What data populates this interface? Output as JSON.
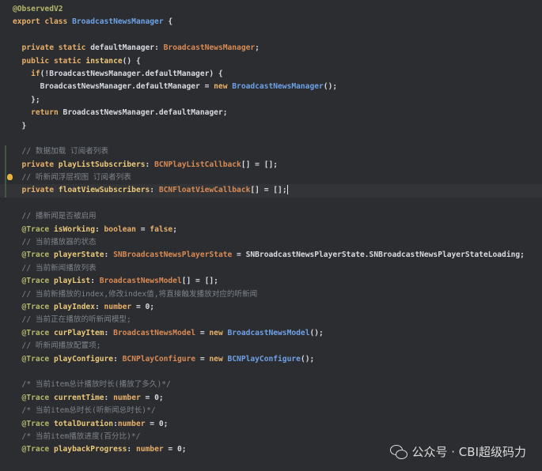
{
  "editor": {
    "lines": [
      {
        "tokens": [
          {
            "t": "@ObservedV2",
            "c": "anno"
          }
        ]
      },
      {
        "tokens": [
          {
            "t": "export class ",
            "c": "kw"
          },
          {
            "t": "BroadcastNewsManager",
            "c": "cls"
          },
          {
            "t": " {",
            "c": "plain"
          }
        ]
      },
      {
        "tokens": []
      },
      {
        "tokens": [
          {
            "t": "  private static ",
            "c": "kw"
          },
          {
            "t": "defaultManager",
            "c": "plain"
          },
          {
            "t": ": ",
            "c": "plain"
          },
          {
            "t": "BroadcastNewsManager",
            "c": "type"
          },
          {
            "t": ";",
            "c": "plain"
          }
        ]
      },
      {
        "tokens": [
          {
            "t": "  public static ",
            "c": "kw"
          },
          {
            "t": "instance",
            "c": "fld"
          },
          {
            "t": "() {",
            "c": "plain"
          }
        ]
      },
      {
        "tokens": [
          {
            "t": "    if",
            "c": "kw"
          },
          {
            "t": "(!BroadcastNewsManager.defaultManager) {",
            "c": "plain"
          }
        ]
      },
      {
        "tokens": [
          {
            "t": "      BroadcastNewsManager.defaultManager = ",
            "c": "plain"
          },
          {
            "t": "new ",
            "c": "kw"
          },
          {
            "t": "BroadcastNewsManager",
            "c": "cls"
          },
          {
            "t": "();",
            "c": "plain"
          }
        ]
      },
      {
        "tokens": [
          {
            "t": "    };",
            "c": "plain"
          }
        ]
      },
      {
        "tokens": [
          {
            "t": "    return ",
            "c": "kw"
          },
          {
            "t": "BroadcastNewsManager.defaultManager;",
            "c": "plain"
          }
        ]
      },
      {
        "tokens": [
          {
            "t": "  }",
            "c": "plain"
          }
        ]
      },
      {
        "tokens": []
      },
      {
        "tokens": [
          {
            "t": "  // 数据加载 订阅者列表",
            "c": "comment"
          }
        ]
      },
      {
        "tokens": [
          {
            "t": "  private ",
            "c": "kw"
          },
          {
            "t": "playListSubscribers",
            "c": "fld"
          },
          {
            "t": ": ",
            "c": "plain"
          },
          {
            "t": "BCNPlayListCallback",
            "c": "type"
          },
          {
            "t": "[] = [];",
            "c": "plain"
          }
        ]
      },
      {
        "tokens": [
          {
            "t": "  // 听新闻浮层视图 订阅者列表",
            "c": "comment"
          }
        ],
        "bulb": true
      },
      {
        "tokens": [
          {
            "t": "  private ",
            "c": "kw"
          },
          {
            "t": "floatViewSubscribers",
            "c": "fld"
          },
          {
            "t": ": ",
            "c": "plain"
          },
          {
            "t": "BCNFloatViewCallback",
            "c": "type"
          },
          {
            "t": "[] = [];",
            "c": "plain"
          }
        ],
        "current": true
      },
      {
        "tokens": []
      },
      {
        "tokens": [
          {
            "t": "  // 播新闻是否被启用",
            "c": "comment"
          }
        ]
      },
      {
        "tokens": [
          {
            "t": "  @Trace ",
            "c": "anno"
          },
          {
            "t": "isWorking",
            "c": "fld"
          },
          {
            "t": ": ",
            "c": "plain"
          },
          {
            "t": "boolean",
            "c": "kw"
          },
          {
            "t": " = ",
            "c": "plain"
          },
          {
            "t": "false",
            "c": "kw"
          },
          {
            "t": ";",
            "c": "plain"
          }
        ]
      },
      {
        "tokens": [
          {
            "t": "  // 当前播放器的状态",
            "c": "comment"
          }
        ]
      },
      {
        "tokens": [
          {
            "t": "  @Trace ",
            "c": "anno"
          },
          {
            "t": "playerState",
            "c": "fld"
          },
          {
            "t": ": ",
            "c": "plain"
          },
          {
            "t": "SNBroadcastNewsPlayerState",
            "c": "type"
          },
          {
            "t": " = SNBroadcastNewsPlayerState.SNBroadcastNewsPlayerStateLoading;",
            "c": "plain"
          }
        ]
      },
      {
        "tokens": [
          {
            "t": "  // 当前新闻播放列表",
            "c": "comment"
          }
        ]
      },
      {
        "tokens": [
          {
            "t": "  @Trace ",
            "c": "anno"
          },
          {
            "t": "playList",
            "c": "fld"
          },
          {
            "t": ": ",
            "c": "plain"
          },
          {
            "t": "BroadcastNewsModel",
            "c": "type"
          },
          {
            "t": "[] = [];",
            "c": "plain"
          }
        ]
      },
      {
        "tokens": [
          {
            "t": "  // 当前新播放的index,修改index值,将直接触发播放对应的听新闻",
            "c": "comment"
          }
        ]
      },
      {
        "tokens": [
          {
            "t": "  @Trace ",
            "c": "anno"
          },
          {
            "t": "playIndex",
            "c": "fld"
          },
          {
            "t": ": ",
            "c": "plain"
          },
          {
            "t": "number",
            "c": "kw"
          },
          {
            "t": " = 0;",
            "c": "plain"
          }
        ]
      },
      {
        "tokens": [
          {
            "t": "  // 当前正在播放的听新闻模型;",
            "c": "comment"
          }
        ]
      },
      {
        "tokens": [
          {
            "t": "  @Trace ",
            "c": "anno"
          },
          {
            "t": "curPlayItem",
            "c": "fld"
          },
          {
            "t": ": ",
            "c": "plain"
          },
          {
            "t": "BroadcastNewsModel",
            "c": "type"
          },
          {
            "t": " = ",
            "c": "plain"
          },
          {
            "t": "new ",
            "c": "kw"
          },
          {
            "t": "BroadcastNewsModel",
            "c": "cls"
          },
          {
            "t": "();",
            "c": "plain"
          }
        ]
      },
      {
        "tokens": [
          {
            "t": "  // 听新闻播放配置项;",
            "c": "comment"
          }
        ]
      },
      {
        "tokens": [
          {
            "t": "  @Trace ",
            "c": "anno"
          },
          {
            "t": "playConfigure",
            "c": "fld"
          },
          {
            "t": ": ",
            "c": "plain"
          },
          {
            "t": "BCNPlayConfigure",
            "c": "type"
          },
          {
            "t": " = ",
            "c": "plain"
          },
          {
            "t": "new ",
            "c": "kw"
          },
          {
            "t": "BCNPlayConfigure",
            "c": "cls"
          },
          {
            "t": "();",
            "c": "plain"
          }
        ]
      },
      {
        "tokens": []
      },
      {
        "tokens": [
          {
            "t": "  /* 当前item总计播放时长(播放了多久)*/",
            "c": "comment"
          }
        ]
      },
      {
        "tokens": [
          {
            "t": "  @Trace ",
            "c": "anno"
          },
          {
            "t": "currentTime",
            "c": "fld"
          },
          {
            "t": ": ",
            "c": "plain"
          },
          {
            "t": "number",
            "c": "kw"
          },
          {
            "t": " = 0;",
            "c": "plain"
          }
        ]
      },
      {
        "tokens": [
          {
            "t": "  /* 当前item总时长(听新闻总时长)*/",
            "c": "comment"
          }
        ]
      },
      {
        "tokens": [
          {
            "t": "  @Trace ",
            "c": "anno"
          },
          {
            "t": "totalDuration",
            "c": "fld"
          },
          {
            "t": ":",
            "c": "plain"
          },
          {
            "t": "number",
            "c": "kw"
          },
          {
            "t": " = 0;",
            "c": "plain"
          }
        ]
      },
      {
        "tokens": [
          {
            "t": "  /* 当前item播放进度(百分比)*/",
            "c": "comment"
          }
        ]
      },
      {
        "tokens": [
          {
            "t": "  @Trace ",
            "c": "anno"
          },
          {
            "t": "playbackProgress",
            "c": "fld"
          },
          {
            "t": ": ",
            "c": "plain"
          },
          {
            "t": "number",
            "c": "kw"
          },
          {
            "t": " = 0;",
            "c": "plain"
          }
        ]
      }
    ]
  },
  "watermark": {
    "icon": "wechat-icon",
    "text": "公众号 · CBI超级码力"
  },
  "colors": {
    "background": "#2b2d30",
    "keyword": "#e8b06a",
    "annotation": "#b5b76b",
    "class": "#6fa1e6",
    "field": "#ecc97a",
    "type": "#d98a55",
    "comment": "#7f848c"
  }
}
